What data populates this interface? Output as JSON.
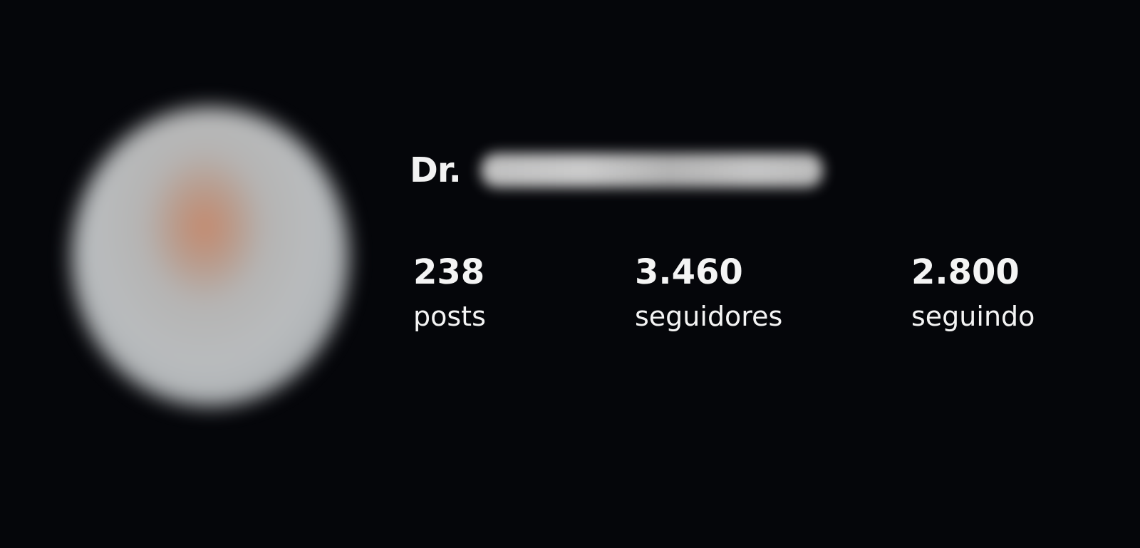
{
  "profile": {
    "name_prefix": "Dr.",
    "stats": [
      {
        "value": "238",
        "label": "posts"
      },
      {
        "value": "3.460",
        "label": "seguidores"
      },
      {
        "value": "2.800",
        "label": "seguindo"
      }
    ]
  },
  "colors": {
    "background": "#05060a",
    "text": "#f4f4f4"
  }
}
